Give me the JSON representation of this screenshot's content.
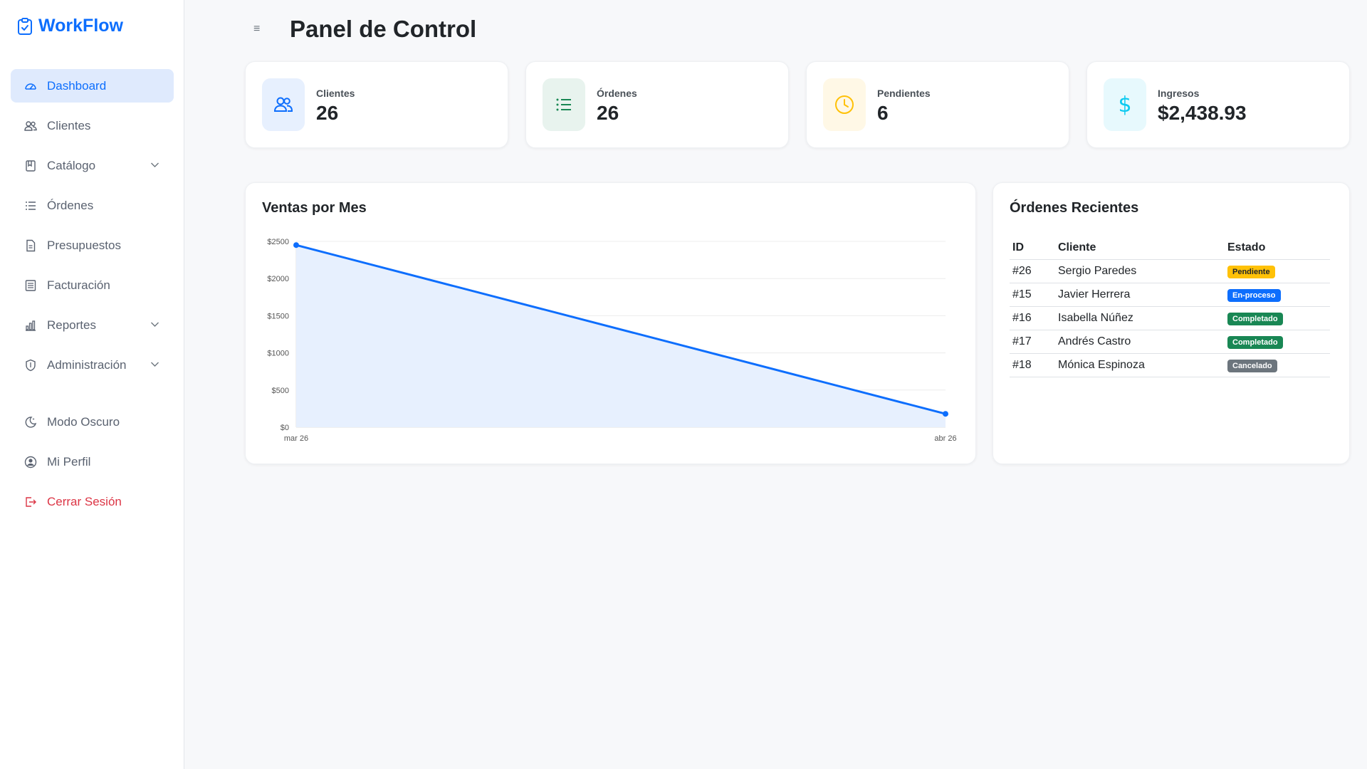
{
  "app": {
    "name": "WorkFlow",
    "brand_color": "#0d6efd"
  },
  "sidebar": {
    "items": [
      {
        "label": "Dashboard",
        "icon": "gauge-icon",
        "active": true
      },
      {
        "label": "Clientes",
        "icon": "users-icon"
      },
      {
        "label": "Catálogo",
        "icon": "book-icon",
        "expandable": true
      },
      {
        "label": "Órdenes",
        "icon": "list-icon"
      },
      {
        "label": "Presupuestos",
        "icon": "document-icon"
      },
      {
        "label": "Facturación",
        "icon": "invoice-icon"
      },
      {
        "label": "Reportes",
        "icon": "bar-chart-icon",
        "expandable": true
      },
      {
        "label": "Administración",
        "icon": "shield-icon",
        "expandable": true
      }
    ],
    "bottom": [
      {
        "label": "Modo Oscuro",
        "icon": "moon-icon"
      },
      {
        "label": "Mi Perfil",
        "icon": "user-circle-icon"
      },
      {
        "label": "Cerrar Sesión",
        "icon": "logout-icon",
        "danger": true
      }
    ]
  },
  "header": {
    "menu_icon": "≡",
    "title": "Panel de Control"
  },
  "stats": [
    {
      "label": "Clientes",
      "value": "26",
      "icon": "users-icon",
      "color": "#0d6efd",
      "bg": "#e7f0fe"
    },
    {
      "label": "Órdenes",
      "value": "26",
      "icon": "list-icon",
      "color": "#198754",
      "bg": "#e8f3ee"
    },
    {
      "label": "Pendientes",
      "value": "6",
      "icon": "clock-icon",
      "color": "#ffc107",
      "bg": "#fff8e6"
    },
    {
      "label": "Ingresos",
      "value": "$2,438.93",
      "icon": "dollar-icon",
      "color": "#0dcaf0",
      "bg": "#e7f9fd"
    }
  ],
  "chart": {
    "title": "Ventas por Mes"
  },
  "chart_data": {
    "type": "area",
    "x": [
      "mar 26",
      "abr 26"
    ],
    "series": [
      {
        "values": [
          2450,
          180
        ]
      }
    ],
    "ylim": [
      0,
      2500
    ],
    "yticks": [
      "$0",
      "$500",
      "$1000",
      "$1500",
      "$2000",
      "$2500"
    ],
    "ytick_values": [
      0,
      500,
      1000,
      1500,
      2000,
      2500
    ],
    "grid": true,
    "line_color": "#0d6efd",
    "fill_color": "#e7f0fe"
  },
  "orders": {
    "title": "Órdenes Recientes",
    "columns": [
      "ID",
      "Cliente",
      "Estado"
    ],
    "rows": [
      {
        "id": "#26",
        "client": "Sergio Paredes",
        "status": "Pendiente",
        "status_type": "warning"
      },
      {
        "id": "#15",
        "client": "Javier Herrera",
        "status": "En-proceso",
        "status_type": "primary"
      },
      {
        "id": "#16",
        "client": "Isabella Núñez",
        "status": "Completado",
        "status_type": "success"
      },
      {
        "id": "#17",
        "client": "Andrés Castro",
        "status": "Completado",
        "status_type": "success"
      },
      {
        "id": "#18",
        "client": "Mónica Espinoza",
        "status": "Cancelado",
        "status_type": "secondary"
      }
    ]
  }
}
